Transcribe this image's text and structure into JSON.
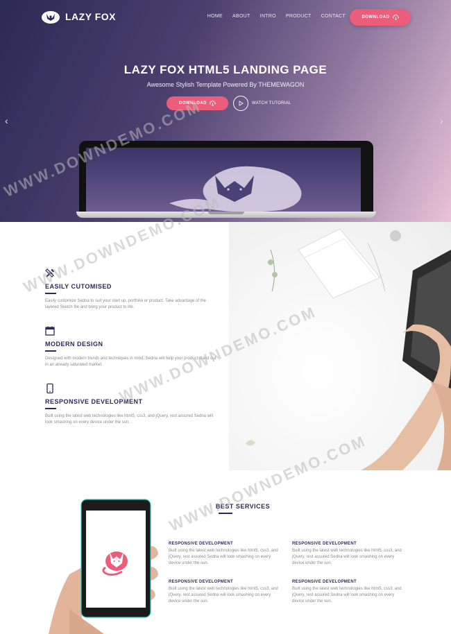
{
  "brand": {
    "name": "LAZY FOX"
  },
  "nav": {
    "items": [
      "HOME",
      "ABOUT",
      "INTRO",
      "PRODUCT",
      "CONTACT"
    ],
    "cta_label": "DOWNLOAD"
  },
  "hero": {
    "title": "LAZY FOX HTML5 LANDING PAGE",
    "subtitle": "Awesome Stylish Template Powered By THEMEWAGON",
    "download_label": "DOWNLOAD",
    "watch_label": "WATCH TUTORIAL"
  },
  "features": [
    {
      "icon": "tools-icon",
      "title": "EASILY CUTOMISED",
      "desc": "Easily customize Sedna to suit your start up, portfolio or product. Take advantage of the layered Sketch file and bring your product to life."
    },
    {
      "icon": "calendar-icon",
      "title": "MODERN DESIGN",
      "desc": "Designed with modern trends and techniques in mind, Sedna will help your product stand out in an already saturated market."
    },
    {
      "icon": "mobile-icon",
      "title": "RESPONSIVE DEVELOPMENT",
      "desc": "Built using the latest web technologies like html5, css3, and jQuery, rest assured Sedna will look smashing on every device under the sun."
    }
  ],
  "services": {
    "title": "BEST SERVICES",
    "items": [
      {
        "title": "RESPONSIVE DEVELOPMENT",
        "desc": "Built using the latest web technologies like html5, css3, and jQuery, rest assured Sedna will look smashing on every device under the sun."
      },
      {
        "title": "RESPONSIVE DEVELOPMENT",
        "desc": "Built using the latest web technologies like html5, css3, and jQuery, rest assured Sedna will look smashing on every device under the sun."
      },
      {
        "title": "RESPONSIVE DEVELOPMENT",
        "desc": "Built using the latest web technologies like html5, css3, and jQuery, rest assured Sedna will look smashing on every device under the sun."
      },
      {
        "title": "RESPONSIVE DEVELOPMENT",
        "desc": "Built using the latest web technologies like html5, css3, and jQuery, rest assured Sedna will look smashing on every device under the sun."
      }
    ]
  },
  "watermark": "WWW.DOWNDEMO.COM",
  "colors": {
    "accent": "#ec5d7b",
    "brand_dark": "#2b2a55"
  }
}
